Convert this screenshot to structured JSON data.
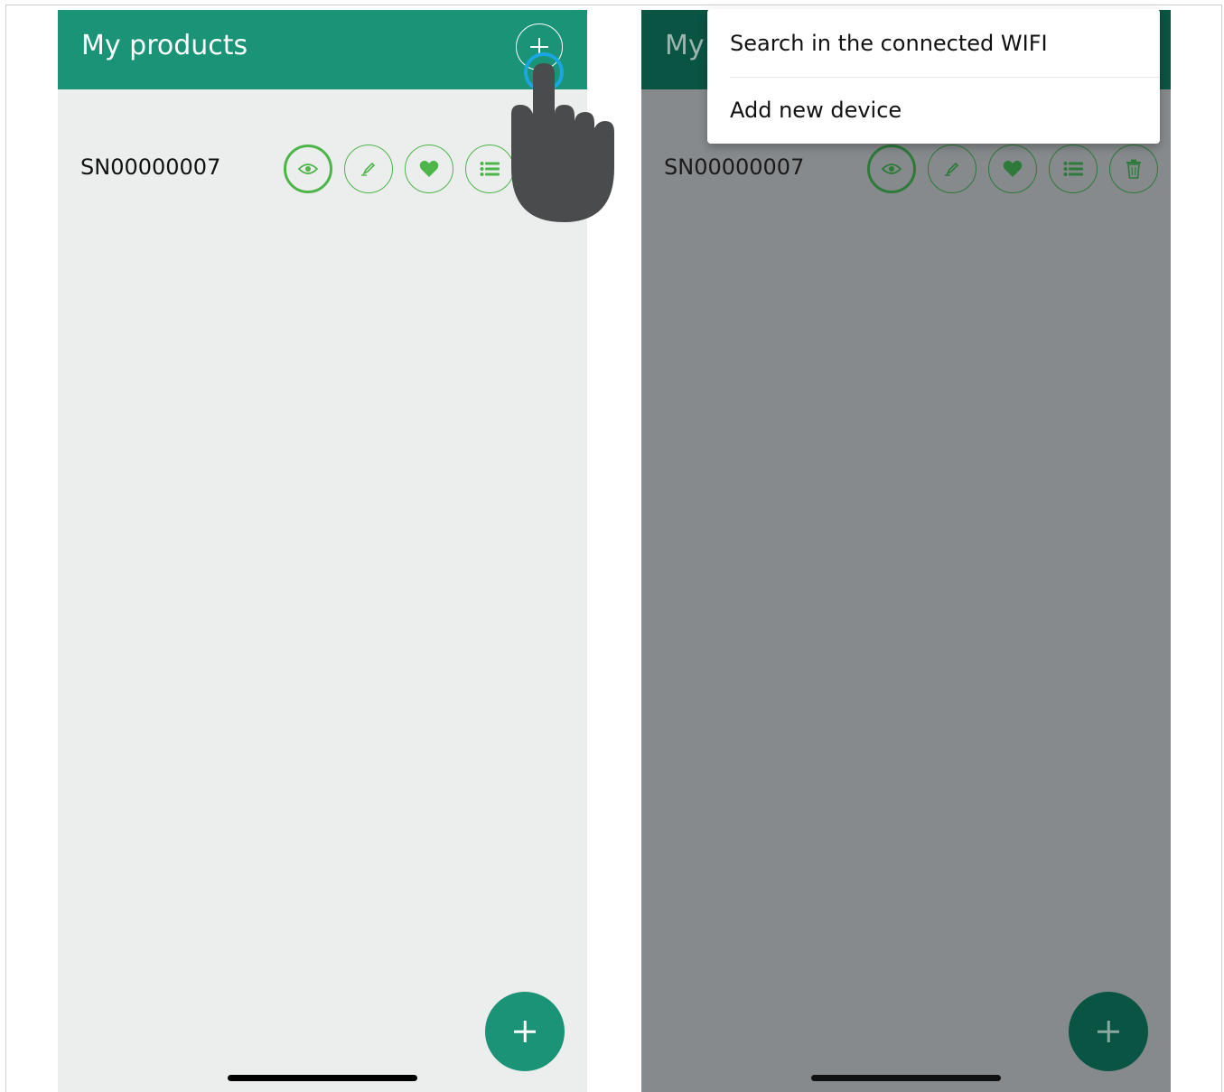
{
  "left_screen": {
    "title": "My products",
    "device": {
      "serial": "SN00000007"
    }
  },
  "right_screen": {
    "title": "My",
    "device": {
      "serial": "SN00000007"
    },
    "menu": {
      "items": [
        "Search in the connected WIFI",
        "Add new device"
      ]
    }
  },
  "icons": [
    "plus-icon",
    "eye-icon",
    "pencil-icon",
    "heart-icon",
    "list-icon",
    "trash-icon",
    "tap-hand-icon"
  ],
  "colors": {
    "appbar": "#1a9376",
    "appbar_dimmed": "#0a5443",
    "background": "#eceeed",
    "overlay_background": "#868a8c",
    "action_green": "#4eb54a",
    "tap_ring": "#1aa6e0",
    "hand": "#4a4b4d"
  }
}
